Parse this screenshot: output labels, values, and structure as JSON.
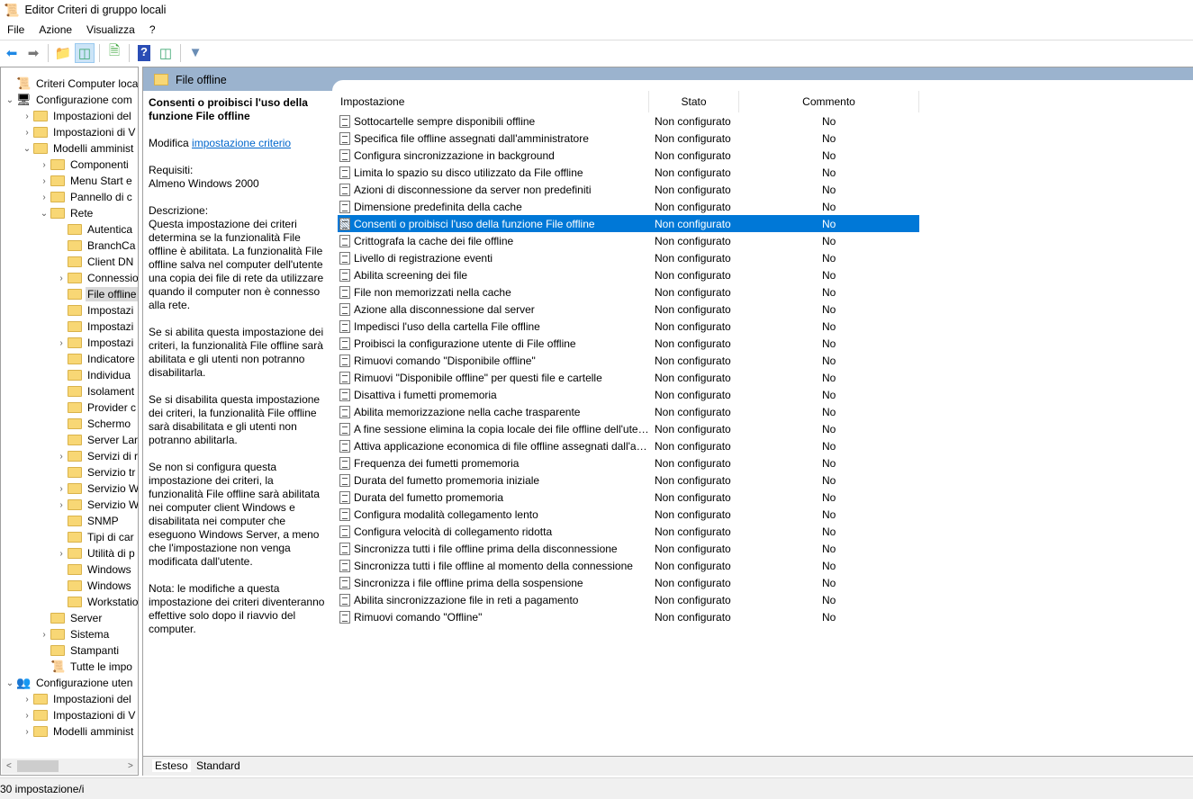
{
  "window": {
    "title": "Editor Criteri di gruppo locali"
  },
  "menu": [
    "File",
    "Azione",
    "Visualizza",
    "?"
  ],
  "tree": [
    {
      "level": 0,
      "exp": "",
      "text": "Criteri Computer locale",
      "icon": "policy-scroll"
    },
    {
      "level": 0,
      "exp": "v",
      "text": "Configurazione com",
      "icon": "computer"
    },
    {
      "level": 1,
      "exp": ">",
      "text": "Impostazioni del"
    },
    {
      "level": 1,
      "exp": ">",
      "text": "Impostazioni di V"
    },
    {
      "level": 1,
      "exp": "v",
      "text": "Modelli amminist"
    },
    {
      "level": 2,
      "exp": ">",
      "text": "Componenti"
    },
    {
      "level": 2,
      "exp": ">",
      "text": "Menu Start e"
    },
    {
      "level": 2,
      "exp": ">",
      "text": "Pannello di c"
    },
    {
      "level": 2,
      "exp": "v",
      "text": "Rete"
    },
    {
      "level": 3,
      "exp": "",
      "text": "Autentica"
    },
    {
      "level": 3,
      "exp": "",
      "text": "BranchCa"
    },
    {
      "level": 3,
      "exp": "",
      "text": "Client DN"
    },
    {
      "level": 3,
      "exp": ">",
      "text": "Connessio"
    },
    {
      "level": 3,
      "exp": "",
      "text": "File offline",
      "selected": true
    },
    {
      "level": 3,
      "exp": "",
      "text": "Impostazi"
    },
    {
      "level": 3,
      "exp": "",
      "text": "Impostazi"
    },
    {
      "level": 3,
      "exp": ">",
      "text": "Impostazi"
    },
    {
      "level": 3,
      "exp": "",
      "text": "Indicatore"
    },
    {
      "level": 3,
      "exp": "",
      "text": "Individua"
    },
    {
      "level": 3,
      "exp": "",
      "text": "Isolament"
    },
    {
      "level": 3,
      "exp": "",
      "text": "Provider c"
    },
    {
      "level": 3,
      "exp": "",
      "text": "Schermo"
    },
    {
      "level": 3,
      "exp": "",
      "text": "Server Lar"
    },
    {
      "level": 3,
      "exp": ">",
      "text": "Servizi di r"
    },
    {
      "level": 3,
      "exp": "",
      "text": "Servizio tr"
    },
    {
      "level": 3,
      "exp": ">",
      "text": "Servizio W"
    },
    {
      "level": 3,
      "exp": ">",
      "text": "Servizio W"
    },
    {
      "level": 3,
      "exp": "",
      "text": "SNMP"
    },
    {
      "level": 3,
      "exp": "",
      "text": "Tipi di car"
    },
    {
      "level": 3,
      "exp": ">",
      "text": "Utilità di p"
    },
    {
      "level": 3,
      "exp": "",
      "text": "Windows"
    },
    {
      "level": 3,
      "exp": "",
      "text": "Windows"
    },
    {
      "level": 3,
      "exp": "",
      "text": "Workstatio"
    },
    {
      "level": 2,
      "exp": "",
      "text": "Server"
    },
    {
      "level": 2,
      "exp": ">",
      "text": "Sistema"
    },
    {
      "level": 2,
      "exp": "",
      "text": "Stampanti"
    },
    {
      "level": 2,
      "exp": "",
      "text": "Tutte le impo",
      "icon": "all-settings"
    },
    {
      "level": 0,
      "exp": "v",
      "text": "Configurazione uten",
      "icon": "user"
    },
    {
      "level": 1,
      "exp": ">",
      "text": "Impostazioni del"
    },
    {
      "level": 1,
      "exp": ">",
      "text": "Impostazioni di V"
    },
    {
      "level": 1,
      "exp": ">",
      "text": "Modelli amminist"
    }
  ],
  "header": {
    "title": "File offline"
  },
  "description": {
    "title": "Consenti o proibisci l'uso della funzione File offline",
    "edit_prefix": "Modifica",
    "edit_link": "impostazione criterio",
    "req_label": "Requisiti:",
    "req_value": "Almeno Windows 2000",
    "desc_label": "Descrizione:",
    "paragraphs": [
      "Questa impostazione dei criteri determina se la funzionalità File offline è abilitata. La funzionalità File offline salva nel computer dell'utente una copia dei file di rete da utilizzare quando il computer non è connesso alla rete.",
      "Se si abilita questa impostazione dei criteri, la funzionalità File offline sarà abilitata e gli utenti non potranno disabilitarla.",
      "Se si disabilita questa impostazione dei criteri, la funzionalità File offline sarà disabilitata e gli utenti non potranno abilitarla.",
      "Se non si configura questa impostazione dei criteri, la funzionalità File offline sarà abilitata nei computer client Windows e disabilitata nei computer che eseguono Windows Server, a meno che l'impostazione non venga modificata dall'utente.",
      "Nota: le modifiche a questa impostazione dei criteri diventeranno effettive solo dopo il riavvio del computer."
    ]
  },
  "columns": {
    "name": "Impostazione",
    "state": "Stato",
    "comment": "Commento"
  },
  "rows": [
    "Sottocartelle sempre disponibili offline",
    "Specifica file offline assegnati dall'amministratore",
    "Configura sincronizzazione in background",
    "Limita lo spazio su disco utilizzato da File offline",
    "Azioni di disconnessione da server non predefiniti",
    "Dimensione predefinita della cache",
    "Consenti o proibisci l'uso della funzione File offline",
    "Crittografa la cache dei file offline",
    "Livello di registrazione eventi",
    "Abilita screening dei file",
    "File non memorizzati nella cache",
    "Azione alla disconnessione dal server",
    "Impedisci l'uso della cartella File offline",
    "Proibisci la configurazione utente di File offline",
    "Rimuovi comando \"Disponibile offline\"",
    "Rimuovi \"Disponibile offline\" per questi file e cartelle",
    "Disattiva i fumetti promemoria",
    "Abilita memorizzazione nella cache trasparente",
    "A fine sessione elimina la copia locale dei file offline dell'utente",
    "Attiva applicazione economica di file offline assegnati dall'amministratore",
    "Frequenza dei fumetti promemoria",
    "Durata del fumetto promemoria iniziale",
    "Durata del fumetto promemoria",
    "Configura modalità collegamento lento",
    "Configura velocità di collegamento ridotta",
    "Sincronizza tutti i file offline prima della disconnessione",
    "Sincronizza tutti i file offline al momento della connessione",
    "Sincronizza i file offline prima della sospensione",
    "Abilita sincronizzazione file in reti a pagamento",
    "Rimuovi comando \"Offline\""
  ],
  "row_state": "Non configurato",
  "row_comment": "No",
  "selected_row": 6,
  "tabs": [
    "Esteso",
    "Standard"
  ],
  "status": "30 impostazione/i"
}
